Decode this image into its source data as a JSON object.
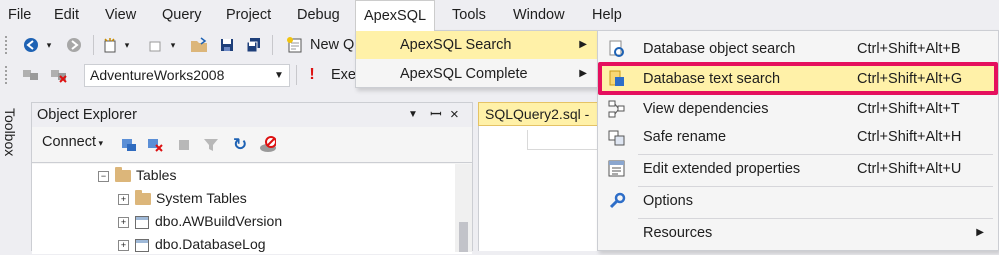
{
  "menubar": {
    "items": [
      {
        "label": "File"
      },
      {
        "label": "Edit"
      },
      {
        "label": "View"
      },
      {
        "label": "Query"
      },
      {
        "label": "Project"
      },
      {
        "label": "Debug"
      },
      {
        "label": "ApexSQL"
      },
      {
        "label": "Tools"
      },
      {
        "label": "Window"
      },
      {
        "label": "Help"
      }
    ]
  },
  "toolbar1": {
    "new_query_label": "New Q"
  },
  "toolbar2": {
    "database_selected": "AdventureWorks2008",
    "execute_label": "Exe"
  },
  "toolbox": {
    "label": "Toolbox"
  },
  "object_explorer": {
    "title": "Object Explorer",
    "connect_label": "Connect",
    "tree": [
      {
        "label": "Tables",
        "expander": "−"
      },
      {
        "label": "System Tables",
        "expander": "+"
      },
      {
        "label": "dbo.AWBuildVersion",
        "expander": "+"
      },
      {
        "label": "dbo.DatabaseLog",
        "expander": "+"
      }
    ]
  },
  "editor": {
    "tab_label": "SQLQuery2.sql - ("
  },
  "apexsql_menu": {
    "items": [
      {
        "label": "ApexSQL Search"
      },
      {
        "label": "ApexSQL Complete"
      }
    ]
  },
  "search_menu": {
    "items": [
      {
        "label": "Database object search",
        "shortcut": "Ctrl+Shift+Alt+B",
        "icon": "db-object-search-icon"
      },
      {
        "label": "Database text search",
        "shortcut": "Ctrl+Shift+Alt+G",
        "icon": "db-text-search-icon"
      },
      {
        "label": "View dependencies",
        "shortcut": "Ctrl+Shift+Alt+T",
        "icon": "dependencies-icon"
      },
      {
        "label": "Safe rename",
        "shortcut": "Ctrl+Shift+Alt+H",
        "icon": "safe-rename-icon"
      },
      {
        "label": "Edit extended properties",
        "shortcut": "Ctrl+Shift+Alt+U",
        "icon": "extended-properties-icon"
      },
      {
        "label": "Options",
        "icon": "options-wrench-icon"
      },
      {
        "label": "Resources"
      }
    ]
  },
  "colors": {
    "highlight_border": "#e5105e",
    "hover_fill": "#fff1a8",
    "menu_background": "#f5f5f5",
    "chrome_background": "#eeeef2"
  }
}
